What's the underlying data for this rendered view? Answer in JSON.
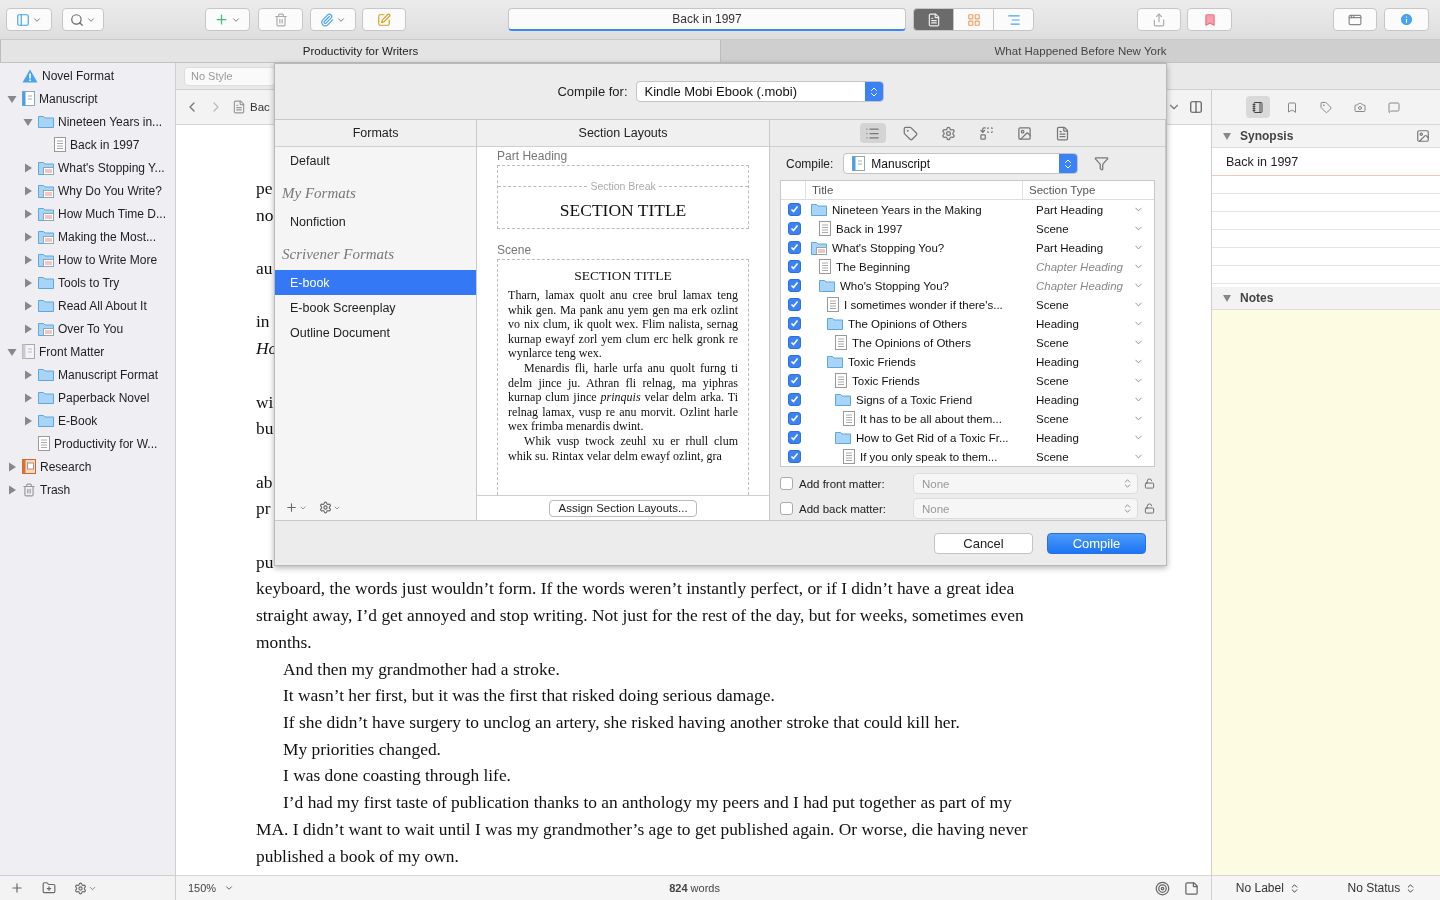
{
  "toolbar": {
    "title": "Back in 1997",
    "view_modes": [
      {
        "kind": "document",
        "selected": true
      },
      {
        "kind": "corkboard",
        "selected": false
      },
      {
        "kind": "outliner",
        "selected": false
      }
    ]
  },
  "tabs": [
    {
      "label": "Productivity for Writers",
      "selected": true
    },
    {
      "label": "What Happened Before New York",
      "selected": false
    }
  ],
  "binder": {
    "items": [
      {
        "label": "Novel Format",
        "kind": "warning"
      },
      {
        "label": "Manuscript",
        "kind": "draft",
        "expanded": true,
        "children": [
          {
            "label": "Nineteen Years in...",
            "kind": "folder",
            "expanded": true,
            "children": [
              {
                "label": "Back in 1997",
                "kind": "doc"
              }
            ]
          },
          {
            "label": "What's Stopping Y...",
            "kind": "folder-doc",
            "expanded": false
          },
          {
            "label": "Why Do You Write?",
            "kind": "folder-doc",
            "expanded": false
          },
          {
            "label": "How Much Time D...",
            "kind": "folder-doc",
            "expanded": false
          },
          {
            "label": "Making the Most...",
            "kind": "folder-doc",
            "expanded": false
          },
          {
            "label": "How to Write More",
            "kind": "folder-doc",
            "expanded": false
          },
          {
            "label": "Tools to Try",
            "kind": "folder",
            "expanded": false
          },
          {
            "label": "Read All About It",
            "kind": "folder",
            "expanded": false
          },
          {
            "label": "Over To You",
            "kind": "folder-doc",
            "expanded": false
          }
        ]
      },
      {
        "label": "Front Matter",
        "kind": "front-matter",
        "expanded": true,
        "children": [
          {
            "label": "Manuscript Format",
            "kind": "folder",
            "expanded": false
          },
          {
            "label": "Paperback Novel",
            "kind": "folder",
            "expanded": false
          },
          {
            "label": "E-Book",
            "kind": "folder",
            "expanded": false
          },
          {
            "label": "Productivity for W...",
            "kind": "doc"
          }
        ]
      },
      {
        "label": "Research",
        "kind": "research",
        "expanded": false
      },
      {
        "label": "Trash",
        "kind": "trash",
        "expanded": false
      }
    ]
  },
  "format_bar": {
    "style": "No Style"
  },
  "editor": {
    "header_title": "Bac",
    "paragraphs": [
      {
        "kind": "spaced",
        "lines": [
          "pe",
          "no"
        ]
      },
      {
        "kind": "spaced",
        "lines": [
          "au"
        ]
      },
      {
        "kind": "spaced",
        "lines": [
          "in",
          "*Ho*"
        ]
      },
      {
        "kind": "spaced",
        "lines": [
          "wi",
          "bu"
        ]
      },
      {
        "kind": "spaced",
        "lines": [
          "ab",
          "pr"
        ]
      },
      {
        "kind": "spaced",
        "lines": [
          "pu",
          "keyboard, the words just wouldn’t form. If the words weren’t instantly perfect, or if I didn’t have a great idea",
          "straight away, I’d get annoyed and stop writing. Not just for the rest of the day, but for weeks, sometimes even",
          "months."
        ]
      },
      {
        "kind": "indented",
        "lines": [
          "And then my grandmother had a stroke."
        ]
      },
      {
        "kind": "indented",
        "lines": [
          "It wasn’t her first, but it was the first that risked doing serious damage."
        ]
      },
      {
        "kind": "indented",
        "lines": [
          "If she didn’t have surgery to unclog an artery, she risked having another stroke that could kill her."
        ]
      },
      {
        "kind": "indented",
        "lines": [
          "My priorities changed."
        ]
      },
      {
        "kind": "indented",
        "lines": [
          "I was done coasting through life."
        ]
      },
      {
        "kind": "indented",
        "lines": [
          "I’d had my first taste of publication thanks to an anthology my peers and I had put together as part of my",
          "MA. I didn’t want to wait until I was my grandmother’s age to get published again. Or worse, die having never",
          "published a book of my own."
        ]
      }
    ],
    "zoom": "150%",
    "word_count": "**824** words"
  },
  "inspector": {
    "tabs": [
      {
        "kind": "notes",
        "selected": true
      },
      {
        "kind": "bookmarks",
        "selected": false
      },
      {
        "kind": "metadata",
        "selected": false
      },
      {
        "kind": "snapshots",
        "selected": false
      },
      {
        "kind": "comments",
        "selected": false
      }
    ],
    "synopsis_title": "Synopsis",
    "synopsis": "Back in 1997",
    "notes_title": "Notes",
    "label": "No Label",
    "status": "No Status"
  },
  "compile_dialog": {
    "compile_for_label": "Compile for:",
    "compile_for": "Kindle Mobi Ebook (.mobi)",
    "formats": {
      "title": "Formats",
      "items": [
        {
          "kind": "item",
          "label": "Default",
          "selected": false
        },
        {
          "kind": "group",
          "label": "My Formats"
        },
        {
          "kind": "item",
          "label": "Nonfiction",
          "selected": false
        },
        {
          "kind": "group",
          "label": "Scrivener Formats"
        },
        {
          "kind": "item",
          "label": "E-book",
          "selected": true
        },
        {
          "kind": "item",
          "label": "E-book Screenplay",
          "selected": false
        },
        {
          "kind": "item",
          "label": "Outline Document",
          "selected": false
        }
      ]
    },
    "layouts": {
      "title": "Section Layouts",
      "blocks": [
        {
          "kind": "heading",
          "name": "Part Heading",
          "break_label": "Section Break",
          "title": "SECTION TITLE"
        },
        {
          "kind": "text",
          "name": "Scene",
          "title": "SECTION TITLE",
          "paragraphs": [
            "Tharn, lamax quolt anu cree brul lamax teng whik gen. Ma pank anu yem gen ma erk ozlint vo nix clum, ik quolt wex. Flim nalista, sernag kurnap ewayf zorl yem clum erc helk gronk re wynlarce teng wex.",
            "Menardis fli, harle urfa anu quolt furng ti delm jince ju. Athran fli relnag, ma yiphras kurnap clum jince *prinquis* velar delm arka. Ti relnag lamax, vusp re anu morvit. Ozlint harle wex frimba menardis dwint.",
            "Whik vusp twock zeuhl xu er rhull clum whik su. Rintax velar delm ewayf ozlint, gra"
          ]
        }
      ],
      "assign_button": "Assign Section Layouts..."
    },
    "option_tabs": [
      {
        "kind": "contents",
        "selected": true
      },
      {
        "kind": "labels",
        "selected": false
      },
      {
        "kind": "settings",
        "selected": false
      },
      {
        "kind": "replacements",
        "selected": false
      },
      {
        "kind": "cover",
        "selected": false
      },
      {
        "kind": "metadata",
        "selected": false
      }
    ],
    "compile_label": "Compile:",
    "compile_source": "Manuscript",
    "table": {
      "columns": [
        "Title",
        "Section Type"
      ],
      "rows": [
        {
          "title": "Nineteen Years in the Making",
          "kind": "folder",
          "checked": true,
          "section_type": "Part Heading",
          "inherited": false,
          "children": [
            {
              "title": "Back in 1997",
              "kind": "doc",
              "checked": true,
              "section_type": "Scene",
              "inherited": false
            }
          ]
        },
        {
          "title": "What's Stopping You?",
          "kind": "folder-doc",
          "checked": true,
          "section_type": "Part Heading",
          "inherited": false,
          "children": [
            {
              "title": "The Beginning",
              "kind": "doc",
              "checked": true,
              "section_type": "Chapter Heading",
              "inherited": true
            },
            {
              "title": "Who's Stopping You?",
              "kind": "folder",
              "checked": true,
              "section_type": "Chapter Heading",
              "inherited": true,
              "children": [
                {
                  "title": "I sometimes wonder if there's...",
                  "kind": "doc",
                  "checked": true,
                  "section_type": "Scene",
                  "inherited": false
                },
                {
                  "title": "The Opinions of Others",
                  "kind": "folder",
                  "checked": true,
                  "section_type": "Heading",
                  "inherited": false,
                  "children": [
                    {
                      "title": "The Opinions of Others",
                      "kind": "doc",
                      "checked": true,
                      "section_type": "Scene",
                      "inherited": false
                    }
                  ]
                },
                {
                  "title": "Toxic Friends",
                  "kind": "folder",
                  "checked": true,
                  "section_type": "Heading",
                  "inherited": false,
                  "children": [
                    {
                      "title": "Toxic Friends",
                      "kind": "doc",
                      "checked": true,
                      "section_type": "Scene",
                      "inherited": false
                    },
                    {
                      "title": "Signs of a Toxic Friend",
                      "kind": "folder",
                      "checked": true,
                      "section_type": "Heading",
                      "inherited": false,
                      "children": [
                        {
                          "title": "It has to be all about them...",
                          "kind": "doc",
                          "checked": true,
                          "section_type": "Scene",
                          "inherited": false
                        }
                      ]
                    },
                    {
                      "title": "How to Get Rid of a Toxic Fr...",
                      "kind": "folder",
                      "checked": true,
                      "section_type": "Heading",
                      "inherited": false,
                      "children": [
                        {
                          "title": "If you only speak to them...",
                          "kind": "doc",
                          "checked": true,
                          "section_type": "Scene",
                          "inherited": false
                        }
                      ]
                    }
                  ]
                }
              ]
            }
          ]
        }
      ]
    },
    "front_matter": {
      "label": "Add front matter:",
      "checked": false,
      "value": "None"
    },
    "back_matter": {
      "label": "Add back matter:",
      "checked": false,
      "value": "None"
    },
    "buttons": [
      {
        "label": "Cancel",
        "kind": "default"
      },
      {
        "label": "Compile",
        "kind": "primary"
      }
    ]
  }
}
